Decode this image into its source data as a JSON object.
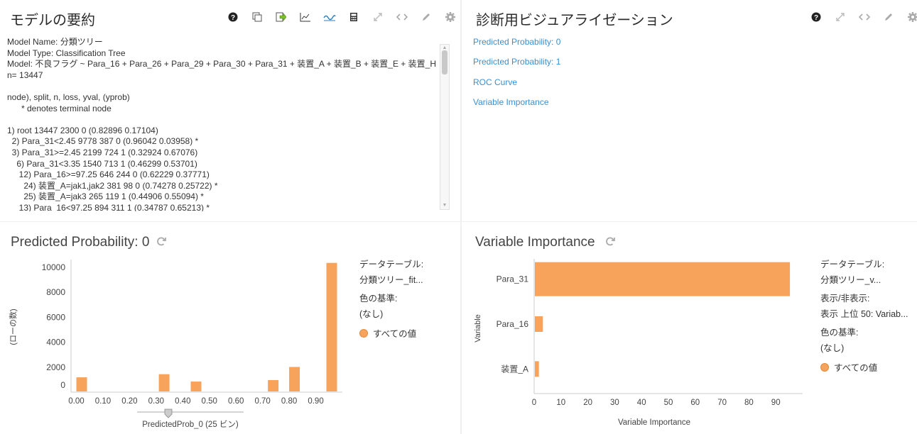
{
  "summary": {
    "title": "モデルの要約",
    "lines": [
      "Model Name: 分類ツリー",
      "Model Type: Classification Tree",
      "Model: 不良フラグ ~ Para_16 + Para_26 + Para_29 + Para_30 + Para_31 + 装置_A + 装置_B + 装置_E + 装置_H",
      "n= 13447",
      "",
      "node), split, n, loss, yval, (yprob)",
      "      * denotes terminal node",
      "",
      "1) root 13447 2300 0 (0.82896 0.17104)",
      "  2) Para_31<2.45 9778 387 0 (0.96042 0.03958) *",
      "  3) Para_31>=2.45 2199 724 1 (0.32924 0.67076)",
      "    6) Para_31<3.35 1540 713 1 (0.46299 0.53701)",
      "     12) Para_16>=97.25 646 244 0 (0.62229 0.37771)",
      "       24) 装置_A=jak1,jak2 381 98 0 (0.74278 0.25722) *",
      "       25) 装置_A=jak3 265 119 1 (0.44906 0.55094) *",
      "     13) Para_16<97.25 894 311 1 (0.34787 0.65213) *"
    ]
  },
  "diagnostics": {
    "title": "診断用ビジュアライゼーション",
    "links": [
      "Predicted Probability: 0",
      "Predicted Probability: 1",
      "ROC Curve",
      "Variable Importance"
    ]
  },
  "pred_panel": {
    "title": "Predicted Probability: 0",
    "legend": {
      "table_label": "データテーブル:",
      "table_value": "分類ツリー_fit...",
      "color_label": "色の基準:",
      "color_value": "(なし)",
      "series_label": "すべての値"
    },
    "slider_label": "PredictedProb_0 (25 ビン)"
  },
  "var_panel": {
    "title": "Variable Importance",
    "legend": {
      "table_label": "データテーブル:",
      "table_value": "分類ツリー_v...",
      "show_label": "表示/非表示:",
      "show_value": "表示 上位 50: Variab...",
      "color_label": "色の基準:",
      "color_value": "(なし)",
      "series_label": "すべての値"
    }
  },
  "colors": {
    "bar": "#f7a35c",
    "link": "#3a8fd0"
  },
  "chart_data": [
    {
      "type": "bar",
      "title": "Predicted Probability: 0",
      "xlabel": "PredictedProb_0 (25 ビン)",
      "ylabel": "(ローの数)",
      "x_ticks": [
        "0.00",
        "0.10",
        "0.20",
        "0.30",
        "0.40",
        "0.50",
        "0.60",
        "0.70",
        "0.80",
        "0.90"
      ],
      "y_ticks": [
        "0",
        "2000",
        "4000",
        "6000",
        "8000",
        "10000"
      ],
      "ylim": [
        0,
        10500
      ],
      "xlim": [
        -0.02,
        1.0
      ],
      "bars": [
        {
          "x": 0.02,
          "y": 620
        },
        {
          "x": 0.33,
          "y": 870
        },
        {
          "x": 0.45,
          "y": 280
        },
        {
          "x": 0.74,
          "y": 400
        },
        {
          "x": 0.82,
          "y": 1450
        },
        {
          "x": 0.96,
          "y": 9778
        }
      ],
      "grid": false,
      "legend": "right"
    },
    {
      "type": "bar",
      "orientation": "horizontal",
      "title": "Variable Importance",
      "xlabel": "Variable Importance",
      "ylabel": "Variable",
      "categories": [
        "Para_31",
        "Para_16",
        "装置_A"
      ],
      "values": [
        95,
        3,
        1.5
      ],
      "x_ticks": [
        "0",
        "10",
        "20",
        "30",
        "40",
        "50",
        "60",
        "70",
        "80",
        "90"
      ],
      "xlim": [
        0,
        100
      ],
      "grid": false,
      "legend": "right"
    }
  ]
}
